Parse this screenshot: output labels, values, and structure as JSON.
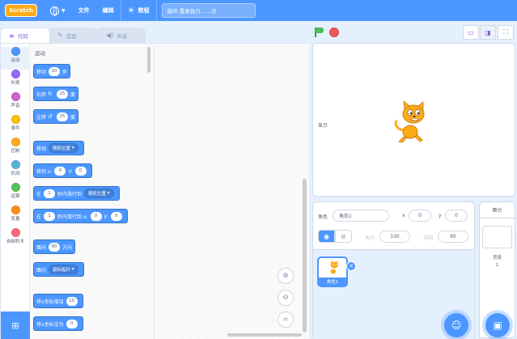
{
  "menubar": {
    "logo": "Scratch",
    "file": "文件",
    "edit": "编辑",
    "tutorials": "教程",
    "project_title": "循环-重复执行……次"
  },
  "tabs": [
    {
      "label": "代码",
      "icon": "code-icon"
    },
    {
      "label": "造型",
      "icon": "paintbrush-icon"
    },
    {
      "label": "声音",
      "icon": "speaker-icon"
    }
  ],
  "categories": [
    {
      "label": "运动",
      "color": "#4c97ff"
    },
    {
      "label": "外观",
      "color": "#9966ff"
    },
    {
      "label": "声音",
      "color": "#cf63cf"
    },
    {
      "label": "事件",
      "color": "#ffbf00"
    },
    {
      "label": "控制",
      "color": "#ffab19"
    },
    {
      "label": "侦测",
      "color": "#5cb1d6"
    },
    {
      "label": "运算",
      "color": "#59c059"
    },
    {
      "label": "变量",
      "color": "#ff8c1a"
    },
    {
      "label": "自制积木",
      "color": "#ff6680"
    }
  ],
  "palette": {
    "section_label": "运动",
    "blocks": {
      "move": {
        "a": "移动",
        "v": "10",
        "b": "步"
      },
      "turn_right": {
        "a": "右转",
        "v": "15",
        "b": "度"
      },
      "turn_left": {
        "a": "左转",
        "v": "15",
        "b": "度"
      },
      "goto": {
        "a": "移到",
        "dd": "随机位置"
      },
      "goto_xy": {
        "a": "移到 x:",
        "x": "0",
        "b": "y:",
        "y": "0"
      },
      "glide_to": {
        "a": "在",
        "v": "1",
        "b": "秒内滑行到",
        "dd": "随机位置"
      },
      "glide_xy": {
        "a": "在",
        "v": "1",
        "b": "秒内滑行到 x:",
        "x": "0",
        "c": "y:",
        "y": "0"
      },
      "point_dir": {
        "a": "面向",
        "v": "90",
        "b": "方向"
      },
      "point_towards": {
        "a": "面向",
        "dd": "鼠标指针"
      },
      "change_x": {
        "a": "将x坐标增加",
        "v": "10"
      },
      "set_x": {
        "a": "将x坐标设为",
        "v": "0"
      }
    }
  },
  "sprite_info": {
    "sprite_label": "角色",
    "sprite_name": "角色1",
    "x_label": "x",
    "x_value": "0",
    "y_label": "y",
    "y_value": "0",
    "show_label": "显示",
    "size_label": "大小",
    "size_value": "100",
    "direction_label": "方向",
    "direction_value": "90"
  },
  "sprite_list": [
    {
      "name": "角色1"
    }
  ],
  "stage_pane": {
    "title": "舞台",
    "backdrops_label": "背景",
    "backdrops_count": "1"
  }
}
